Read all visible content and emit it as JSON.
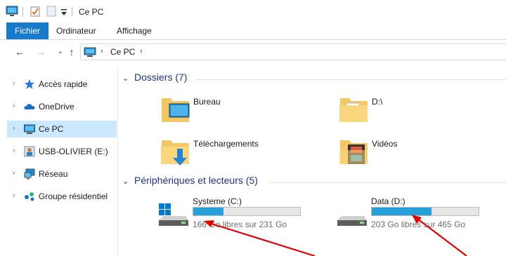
{
  "window": {
    "title": "Ce PC"
  },
  "ribbon": {
    "tabs": [
      {
        "label": "Fichier"
      },
      {
        "label": "Ordinateur"
      },
      {
        "label": "Affichage"
      }
    ]
  },
  "address": {
    "crumb": "Ce PC"
  },
  "nav": {
    "items": [
      {
        "label": "Accès rapide"
      },
      {
        "label": "OneDrive"
      },
      {
        "label": "Ce PC"
      },
      {
        "label": "USB-OLIVIER (E:)"
      },
      {
        "label": "Réseau"
      },
      {
        "label": "Groupe résidentiel"
      }
    ]
  },
  "folders": {
    "header": "Dossiers (7)",
    "items": [
      {
        "label": "Bureau"
      },
      {
        "label": "D:\\"
      },
      {
        "label": "Téléchargements"
      },
      {
        "label": "Vidéos"
      }
    ]
  },
  "drives": {
    "header": "Périphériques et lecteurs (5)",
    "items": [
      {
        "name": "Systeme (C:)",
        "free": "166 Go libres sur 231 Go",
        "used_fraction": 0.28
      },
      {
        "name": "Data (D:)",
        "free": "203 Go libres sur 465 Go",
        "used_fraction": 0.56
      }
    ]
  },
  "colors": {
    "accent": "#1979ca",
    "selection": "#cce8ff",
    "bar_fill": "#26a0da",
    "group_title": "#1e3287",
    "arrow": "#e00000"
  }
}
